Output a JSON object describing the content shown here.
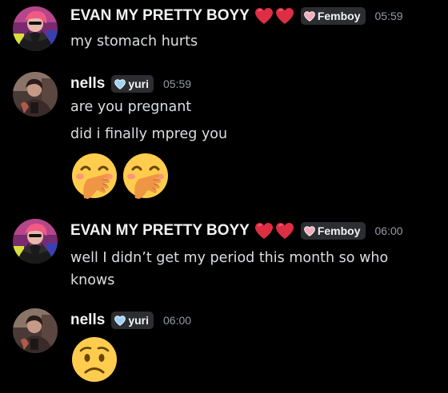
{
  "colors": {
    "background": "#000000",
    "username": "#f2f3f5",
    "message_text": "#dbdee1",
    "timestamp": "#949ba4",
    "tag_bg": "#2b2d31",
    "heart": "#dd2e44",
    "femboy_heart": "#f4abba",
    "yuri_heart": "#9fd3f5",
    "emoji_face": "#ffcc4d"
  },
  "messages": [
    {
      "author": "EVAN MY PRETTY BOYY",
      "name_hearts": [
        "red-heart-emoji",
        "red-heart-emoji"
      ],
      "tag": {
        "icon": "pink-heart-icon",
        "label": "Femboy"
      },
      "time": "05:59",
      "lines": [
        "my stomach hurts"
      ]
    },
    {
      "author": "nells",
      "tag": {
        "icon": "light-blue-heart-icon",
        "label": "yuri"
      },
      "time": "05:59",
      "lines": [
        "are you pregnant",
        "did i finally mpreg you"
      ],
      "emojis": [
        "hand-over-mouth-emoji",
        "hand-over-mouth-emoji"
      ]
    },
    {
      "author": "EVAN MY PRETTY BOYY",
      "name_hearts": [
        "red-heart-emoji",
        "red-heart-emoji"
      ],
      "tag": {
        "icon": "pink-heart-icon",
        "label": "Femboy"
      },
      "time": "06:00",
      "lines": [
        "well I didn’t get my period this month so who knows"
      ]
    },
    {
      "author": "nells",
      "tag": {
        "icon": "light-blue-heart-icon",
        "label": "yuri"
      },
      "time": "06:00",
      "emojis": [
        "worried-face-emoji"
      ]
    }
  ]
}
